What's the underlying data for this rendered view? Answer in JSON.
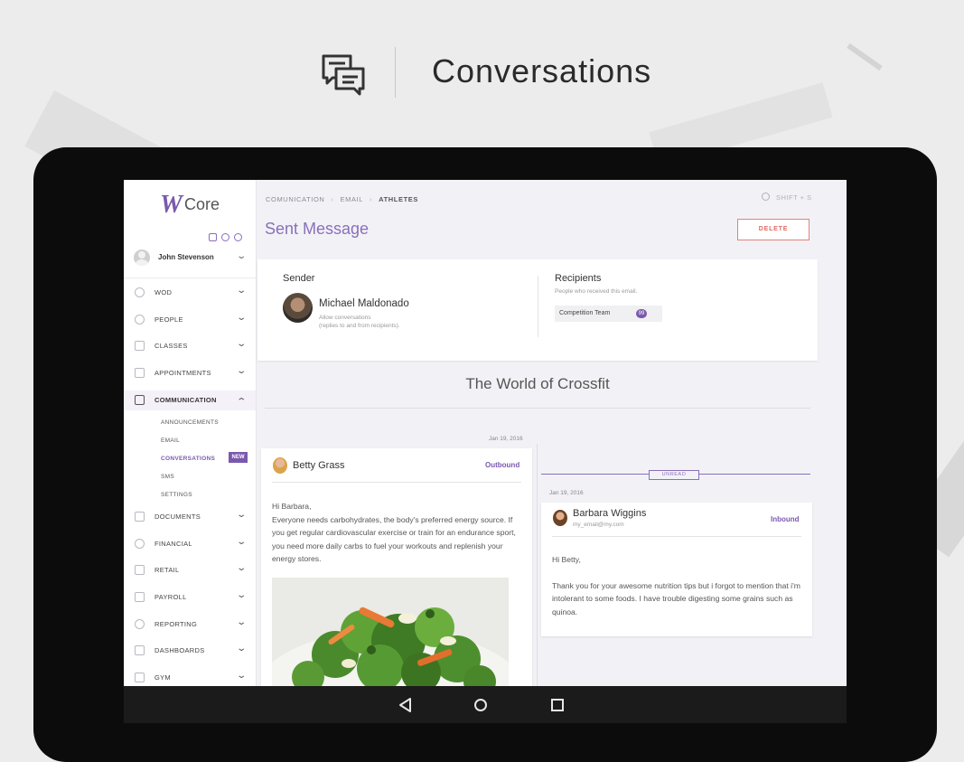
{
  "hero": {
    "title": "Conversations",
    "icon": "conversations-icon"
  },
  "app": {
    "logo_mark": "W",
    "logo_text": "Core",
    "user_name": "John Stevenson"
  },
  "sidebar": {
    "items": [
      {
        "label": "WOD",
        "icon": "timer-icon"
      },
      {
        "label": "PEOPLE",
        "icon": "person-icon"
      },
      {
        "label": "CLASSES",
        "icon": "calendar-icon"
      },
      {
        "label": "APPOINTMENTS",
        "icon": "appointments-icon"
      },
      {
        "label": "COMMUNICATION",
        "icon": "chat-icon"
      },
      {
        "label": "DOCUMENTS",
        "icon": "folder-icon"
      },
      {
        "label": "FINANCIAL",
        "icon": "dollar-icon"
      },
      {
        "label": "RETAIL",
        "icon": "cart-icon"
      },
      {
        "label": "PAYROLL",
        "icon": "payroll-icon"
      },
      {
        "label": "REPORTING",
        "icon": "report-icon"
      },
      {
        "label": "DASHBOARDS",
        "icon": "dashboard-icon"
      },
      {
        "label": "GYM",
        "icon": "gym-icon"
      }
    ],
    "submenu": [
      "ANNOUNCEMENTS",
      "EMAIL",
      "CONVERSATIONS",
      "SMS",
      "SETTINGS"
    ],
    "new_badge": "NEW"
  },
  "breadcrumb": {
    "a": "COMUNICATION",
    "b": "EMAIL",
    "c": "ATHLETES"
  },
  "search_hint": "SHIFT + S",
  "page_title": "Sent Message",
  "delete_label": "DELETE",
  "sender": {
    "heading": "Sender",
    "name": "Michael Maldonado",
    "note_1": "Allow conversations",
    "note_2": "(replies to and from recipients)."
  },
  "recipients": {
    "heading": "Recipients",
    "sub": "People who received this email.",
    "chip_label": "Competition Team",
    "chip_count": "99"
  },
  "conversation": {
    "title": "The World of Crossfit",
    "unread_label": "UNREAD",
    "messages": [
      {
        "date": "Jan 19, 2016",
        "name": "Betty Grass",
        "direction": "Outbound",
        "greeting": "Hi Barbara,",
        "body": "Everyone needs carbohydrates, the body's preferred energy source. If you get regular cardiovascular exercise or train for an endurance sport, you need more daily carbs to fuel your workouts and replenish your energy stores."
      },
      {
        "date": "Jan 19, 2016",
        "name": "Barbara Wiggins",
        "email": "my_email@my.com",
        "direction": "Inbound",
        "greeting": "Hi Betty,",
        "body": "Thank you for your awesome nutrition tips but i forgot to mention that i'm intolerant to some foods. I have trouble digesting some grains such as quinoa."
      }
    ]
  },
  "colors": {
    "accent": "#7a59ad",
    "danger": "#e06863",
    "background": "#f2f2f6"
  }
}
